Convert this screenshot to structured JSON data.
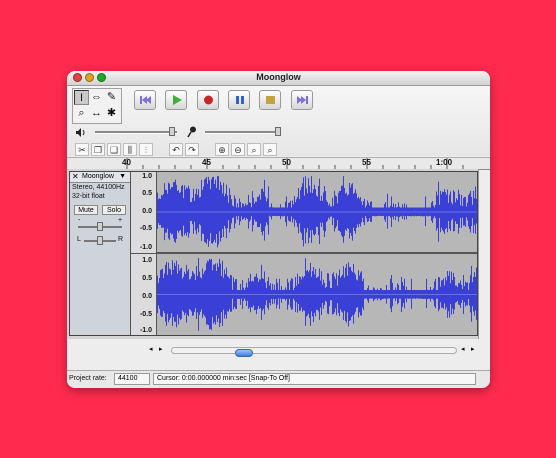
{
  "window": {
    "title": "Moonglow"
  },
  "tools": {
    "selection": "I",
    "envelope": "⇔",
    "draw": "✎",
    "zoom": "⌕",
    "timeshift": "↔",
    "multi": "✱"
  },
  "transport": {
    "skip_start": "skip-start-icon",
    "play": "play-icon",
    "record": "record-icon",
    "pause": "pause-icon",
    "stop": "stop-icon",
    "skip_end": "skip-end-icon",
    "colors": {
      "play": "#3fae3f",
      "record": "#c8262a",
      "pause": "#2f5fd0",
      "stop": "#c2a43a",
      "skip": "#7b6fd8"
    }
  },
  "mixer": {
    "output_volume": 0.93,
    "input_volume": 0.95
  },
  "ruler": {
    "labels": [
      "40",
      "45",
      "50",
      "55",
      "1:00"
    ]
  },
  "track": {
    "name": "Moonglow",
    "format": "Stereo, 44100Hz",
    "bit_depth": "32-bit float",
    "mute_label": "Mute",
    "solo_label": "Solo",
    "gain_minus": "-",
    "gain_plus": "+",
    "pan_left": "L",
    "pan_right": "R",
    "scale_labels": [
      "1.0",
      "0.5",
      "0.0",
      "-0.5",
      "-1.0"
    ],
    "waveform_color": "#3a3fd6"
  },
  "status": {
    "project_rate_label": "Project rate:",
    "project_rate_value": "44100",
    "cursor_text": "Cursor: 0:00.000000 min:sec  [Snap-To Off]"
  }
}
